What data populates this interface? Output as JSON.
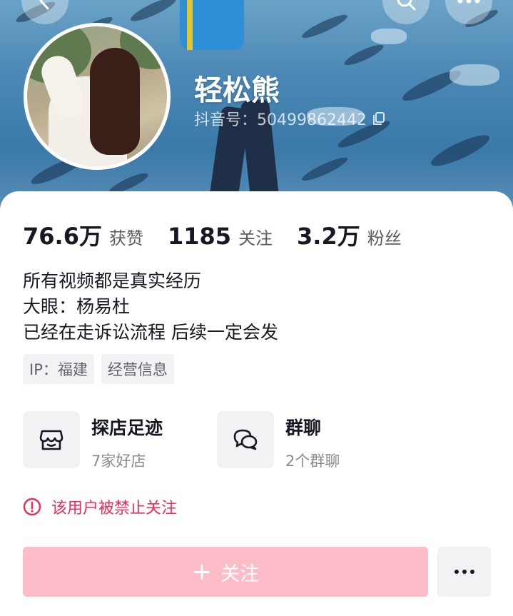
{
  "profile": {
    "name": "轻松熊",
    "douyin_id": "抖音号：50499862442"
  },
  "stats": [
    {
      "value": "76.6万",
      "label": "获赞"
    },
    {
      "value": "1185",
      "label": "关注"
    },
    {
      "value": "3.2万",
      "label": "粉丝"
    }
  ],
  "bio": [
    "所有视频都是真实经历",
    "大眼：杨易杜",
    "已经在走诉讼流程 后续一定会发"
  ],
  "tags": [
    "IP：福建",
    "经营信息"
  ],
  "cards": [
    {
      "title": "探店足迹",
      "subtitle": "7家好店",
      "icon": "store-icon"
    },
    {
      "title": "群聊",
      "subtitle": "2个群聊",
      "icon": "chat-bubbles-icon"
    }
  ],
  "warning": {
    "text": "该用户被禁止关注",
    "color": "#f02c54"
  },
  "actions": {
    "follow_label": "关注",
    "follow_color": "#fcbdc9"
  }
}
